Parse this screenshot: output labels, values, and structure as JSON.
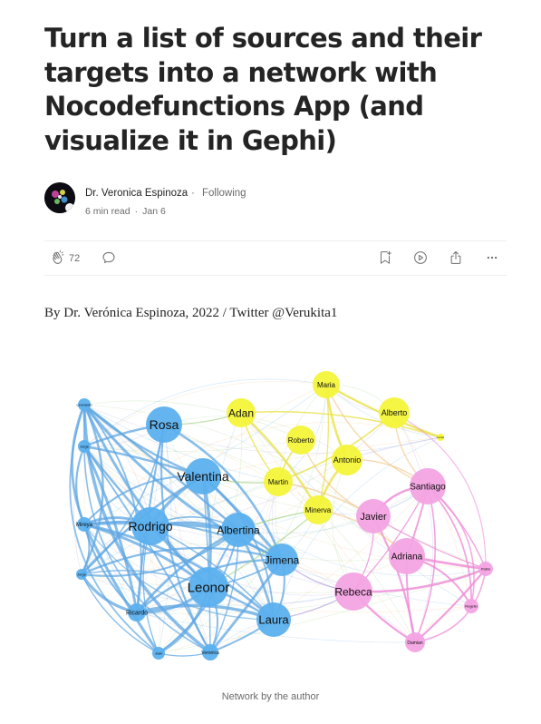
{
  "article": {
    "title": "Turn a list of sources and their targets into a network with Nocodefunctions App (and visualize it in Gephi)",
    "author": "Dr. Veronica Espinoza",
    "follow_status": "Following",
    "separator": "·",
    "read_time": "6 min read",
    "date": "Jan 6",
    "byline": "By Dr. Verónica Espinoza, 2022 / Twitter @Verukita1",
    "caption": "Network by the author"
  },
  "actions": {
    "clap_count": "72",
    "icons": [
      "clap-icon",
      "comment-icon",
      "save-icon",
      "listen-icon",
      "share-icon",
      "more-icon"
    ]
  },
  "network": {
    "colors": {
      "blue": "#5bb0ee",
      "yellow": "#f4f43a",
      "pink": "#f3a3e3",
      "edge_blue": "#5fa7e3",
      "edge_green": "#9ccf7c",
      "edge_yellow": "#e8e24a",
      "edge_orange": "#f2c07e",
      "edge_pink": "#ee8ad6",
      "edge_purple": "#a695dc"
    },
    "nodes": [
      {
        "label": "Rosa",
        "group": "blue"
      },
      {
        "label": "Valentina",
        "group": "blue"
      },
      {
        "label": "Rodrigo",
        "group": "blue"
      },
      {
        "label": "Albertina",
        "group": "blue"
      },
      {
        "label": "Jimena",
        "group": "blue"
      },
      {
        "label": "Leonor",
        "group": "blue"
      },
      {
        "label": "Laura",
        "group": "blue"
      },
      {
        "label": "Mireya",
        "group": "blue"
      },
      {
        "label": "Ricardo",
        "group": "blue"
      },
      {
        "label": "Juan",
        "group": "blue"
      },
      {
        "label": "Veronica",
        "group": "blue"
      },
      {
        "label": "Leonardo",
        "group": "blue"
      },
      {
        "label": "Jorge",
        "group": "blue"
      },
      {
        "label": "Jorge",
        "group": "blue"
      },
      {
        "label": "Maria",
        "group": "yellow"
      },
      {
        "label": "Adan",
        "group": "yellow"
      },
      {
        "label": "Alberto",
        "group": "yellow"
      },
      {
        "label": "Roberto",
        "group": "yellow"
      },
      {
        "label": "Antonio",
        "group": "yellow"
      },
      {
        "label": "Martin",
        "group": "yellow"
      },
      {
        "label": "Minerva",
        "group": "yellow"
      },
      {
        "label": "Lucas",
        "group": "yellow"
      },
      {
        "label": "Santiago",
        "group": "pink"
      },
      {
        "label": "Javier",
        "group": "pink"
      },
      {
        "label": "Adriana",
        "group": "pink"
      },
      {
        "label": "Rebeca",
        "group": "pink"
      },
      {
        "label": "Damian",
        "group": "pink"
      },
      {
        "label": "Pablo",
        "group": "pink"
      },
      {
        "label": "Rogelio",
        "group": "pink"
      }
    ]
  }
}
